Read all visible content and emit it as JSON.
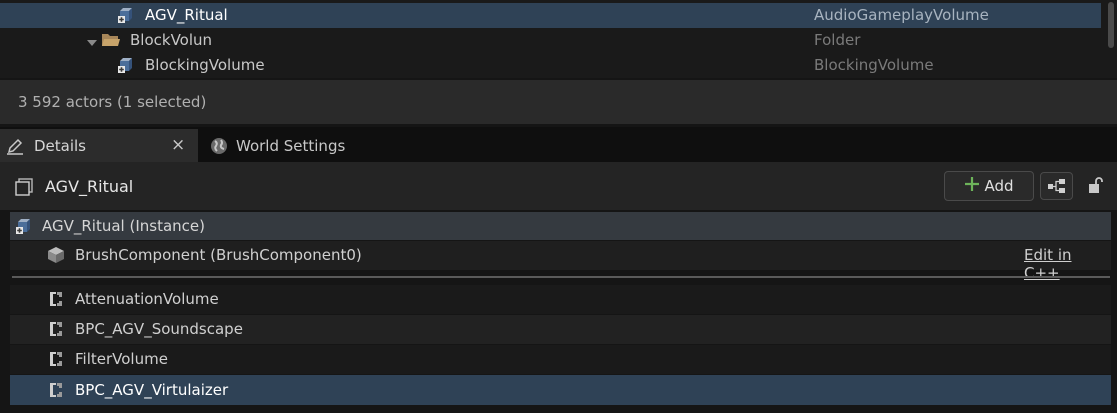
{
  "outliner": {
    "rows": [
      {
        "label": "AGV_Ritual",
        "type": "AudioGameplayVolume",
        "selected": true,
        "icon": "volume-icon"
      },
      {
        "label": "BlockVolun",
        "type": "Folder",
        "selected": false,
        "icon": "folder-icon"
      },
      {
        "label": "BlockingVolume",
        "type": "BlockingVolume",
        "selected": false,
        "icon": "volume-icon"
      }
    ],
    "status": "3 592 actors (1 selected)"
  },
  "tabs": [
    {
      "label": "Details",
      "icon": "pencil-icon",
      "active": true
    },
    {
      "label": "World Settings",
      "icon": "globe-icon",
      "active": false
    }
  ],
  "tab_close": "×",
  "details": {
    "actor_name": "AGV_Ritual",
    "add_label": "Add",
    "components": [
      {
        "label": "AGV_Ritual (Instance)",
        "icon": "volume-icon",
        "level": 0
      },
      {
        "label": "BrushComponent (BrushComponent0)",
        "icon": "cube-icon",
        "level": 1,
        "action": "Edit in C++"
      },
      {
        "label": "AttenuationVolume",
        "icon": "class-icon",
        "level": 1
      },
      {
        "label": "BPC_AGV_Soundscape",
        "icon": "class-icon",
        "level": 1
      },
      {
        "label": "FilterVolume",
        "icon": "class-icon",
        "level": 1
      },
      {
        "label": "BPC_AGV_Virtulaizer",
        "icon": "class-icon",
        "level": 1,
        "selected": true
      }
    ]
  },
  "colors": {
    "selection": "#2f4256",
    "add_plus": "#6db35a",
    "folder": "#c7a36a"
  }
}
